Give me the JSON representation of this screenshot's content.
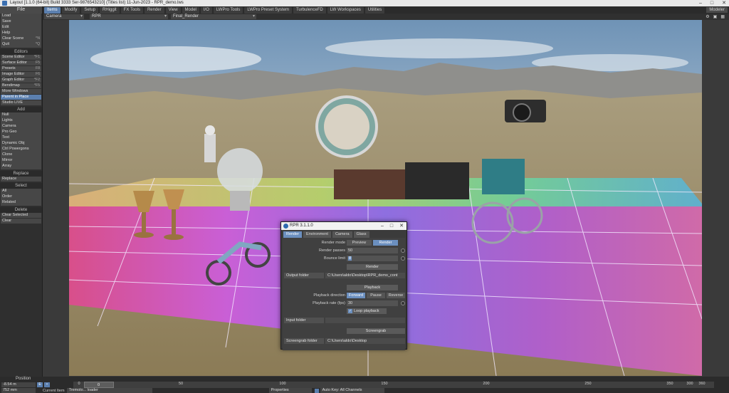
{
  "window": {
    "title": "Layout [1.1.0 (64-bit) Build 3333 Ser-9876543210] (Titles list) 11-Jun-2023 - RPR_demo.lws",
    "modeler_label": "Modeler"
  },
  "menu": {
    "file_label": "File",
    "tabs": [
      "Items",
      "Modify",
      "Setup",
      "RHiggit",
      "FX Tools",
      "Render",
      "View",
      "Model",
      "I/O",
      "LWPro Tools",
      "LWPro Preset System",
      "TurbulenceFD",
      "LW Workspaces",
      "Utilities"
    ],
    "active_tab": "Items"
  },
  "viewport_header": {
    "view_select": "Camera",
    "camera_select": "RPR",
    "render_select": "Final_Render"
  },
  "left_panel": {
    "top_buttons": [
      {
        "label": "Load",
        "shortcut": ""
      },
      {
        "label": "Save",
        "shortcut": ""
      },
      {
        "label": "Edit",
        "shortcut": ""
      },
      {
        "label": "Help",
        "shortcut": ""
      },
      {
        "label": "Clear Scene",
        "shortcut": "^N"
      },
      {
        "label": "Quit",
        "shortcut": "^Q"
      }
    ],
    "editors_title": "Editors",
    "editors": [
      {
        "label": "Scene Editor",
        "shortcut": "^F1"
      },
      {
        "label": "Surface Editor",
        "shortcut": "F5"
      },
      {
        "label": "Presets",
        "shortcut": "F8"
      },
      {
        "label": "Image Editor",
        "shortcut": "F6"
      },
      {
        "label": "Graph Editor",
        "shortcut": "^F2"
      },
      {
        "label": "Bendimap",
        "shortcut": "^F5"
      },
      {
        "label": "More Windows",
        "shortcut": ""
      },
      {
        "label": "Parent in Place",
        "shortcut": ""
      },
      {
        "label": "Studio LIVE",
        "shortcut": ""
      }
    ],
    "add_title": "Add",
    "add": [
      {
        "label": "Null",
        "shortcut": ""
      },
      {
        "label": "Lights",
        "shortcut": ""
      },
      {
        "label": "Camera",
        "shortcut": ""
      },
      {
        "label": "Pro Geo",
        "shortcut": ""
      },
      {
        "label": "Text",
        "shortcut": ""
      },
      {
        "label": "Dynamic Obj",
        "shortcut": ""
      },
      {
        "label": "Ctrl Powergons",
        "shortcut": ""
      },
      {
        "label": "Clone",
        "shortcut": ""
      },
      {
        "label": "Mirror",
        "shortcut": ""
      },
      {
        "label": "Array",
        "shortcut": ""
      }
    ],
    "replace_title": "Replace",
    "replace": [
      {
        "label": "Replace",
        "shortcut": ""
      }
    ],
    "select_title": "Select",
    "select": [
      {
        "label": "All",
        "shortcut": ""
      },
      {
        "label": "Order",
        "shortcut": ""
      },
      {
        "label": "Related",
        "shortcut": ""
      }
    ],
    "delete_title": "Delete",
    "delete": [
      {
        "label": "Clear Selected",
        "shortcut": ""
      },
      {
        "label": "Clear",
        "shortcut": ""
      }
    ]
  },
  "rpr_dialog": {
    "title": "RPR 3.1.1.0",
    "tabs": [
      "Render",
      "Environment",
      "Camera",
      "Glass"
    ],
    "active_tab": "Render",
    "render_mode_label": "Render mode",
    "render_mode_options": [
      "Preview",
      "Render"
    ],
    "render_mode_selected": "Render",
    "render_passes_label": "Render passes",
    "render_passes_value": "50",
    "bounce_limit_label": "Bounce limit",
    "bounce_limit_value": "8",
    "render_button": "Render",
    "output_folder_label": "Output folder",
    "output_folder_value": "C:\\Users\\aldo\\Desktop\\RPR_demo_cont",
    "playback_button": "Playback",
    "playback_direction_label": "Playback direction",
    "playback_direction_options": [
      "Forward",
      "Pause",
      "Reverse"
    ],
    "playback_direction_selected": "Forward",
    "playback_rate_label": "Playback rate (fps)",
    "playback_rate_value": "30",
    "loop_playback_label": "Loop playback",
    "input_folder_label": "Input folder",
    "input_folder_value": "",
    "screengrab_button": "Screengrab",
    "screengrab_folder_label": "Screengrab folder",
    "screengrab_folder_value": "C:\\Users\\aldo\\Desktop"
  },
  "timeline": {
    "position_label": "Position",
    "position_value": "-8.54 m",
    "position_value2": "752 mm",
    "current_frame": "0",
    "ruler_ticks": [
      "0",
      "50",
      "100",
      "150",
      "200",
      "250",
      "300",
      "350",
      "360"
    ],
    "current_item_label": "Current Item",
    "current_item_value": "Tremolo... loader",
    "properties_label": "Properties",
    "auto_key_label": "Auto Key: All Channels"
  },
  "colors": {
    "accent": "#5b7fae",
    "panel_bg": "#2f2f2f",
    "button_bg": "#474747"
  }
}
